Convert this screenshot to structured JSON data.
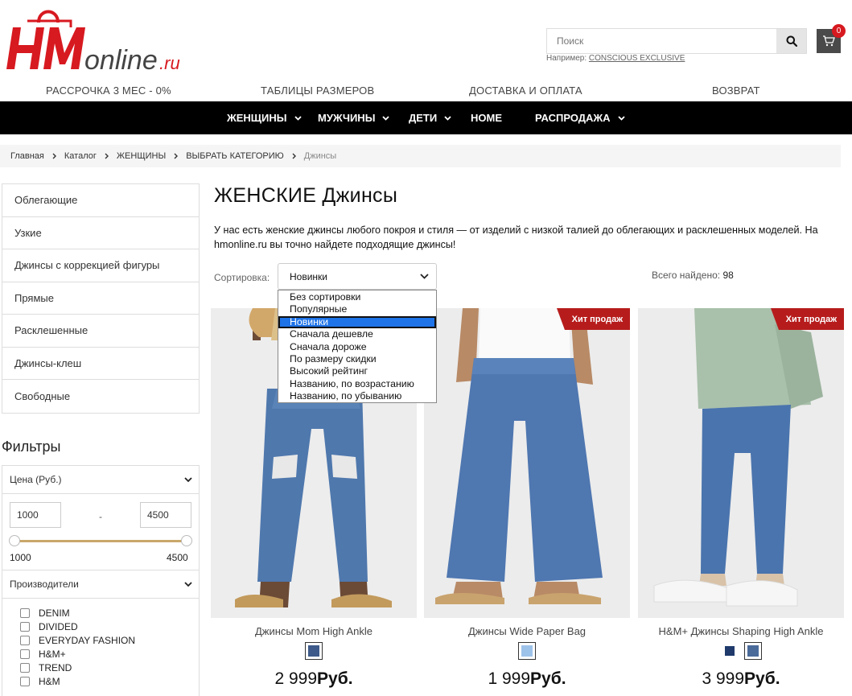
{
  "logo": {
    "brand": "HM",
    "suffix": "online",
    "tld": ".ru"
  },
  "search": {
    "placeholder": "Поиск",
    "hint_prefix": "Например:",
    "hint_link": "CONSCIOUS EXCLUSIVE"
  },
  "cart": {
    "count": "0"
  },
  "infobar": [
    "РАССРОЧКА 3 МЕС - 0%",
    "ТАБЛИЦЫ РАЗМЕРОВ",
    "ДОСТАВКА И ОПЛАТА",
    "ВОЗВРАТ"
  ],
  "nav": [
    "ЖЕНЩИНЫ",
    "МУЖЧИНЫ",
    "ДЕТИ",
    "HOME",
    "РАСПРОДАЖА"
  ],
  "breadcrumb": [
    "Главная",
    "Каталог",
    "ЖЕНЩИНЫ",
    "ВЫБРАТЬ КАТЕГОРИЮ",
    "Джинсы"
  ],
  "categories": [
    "Облегающие",
    "Узкие",
    "Джинсы с коррекцией фигуры",
    "Прямые",
    "Расклешенные",
    "Джинсы-клеш",
    "Свободные"
  ],
  "filters": {
    "title": "Фильтры",
    "price_label": "Цена (Руб.)",
    "price_min": "1000",
    "price_max": "4500",
    "dash": "-",
    "range_min": "1000",
    "range_max": "4500",
    "brands_label": "Производители",
    "brands": [
      "DENIM",
      "DIVIDED",
      "EVERYDAY FASHION",
      "H&M+",
      "TREND",
      "H&M"
    ]
  },
  "page": {
    "title": "ЖЕНСКИЕ Джинсы",
    "intro": "У нас есть женские джинсы любого покроя и стиля — от изделий с низкой талией до облегающих и расклешенных моделей. На hmonline.ru вы точно найдете подходящие джинсы!"
  },
  "sort": {
    "label": "Сортировка:",
    "selected": "Новинки",
    "options": [
      "Без сортировки",
      "Популярные",
      "Новинки",
      "Сначала дешевле",
      "Сначала дороже",
      "По размеру скидки",
      "Высокий рейтинг",
      "Названию, по возрастанию",
      "Названию, по убыванию"
    ]
  },
  "total": {
    "label": "Всего найдено:",
    "value": "98"
  },
  "products": [
    {
      "name": "Джинсы Mom High Ankle",
      "badge": "",
      "price": "2 999",
      "currency": "Руб.",
      "swatches": [
        "#3d5a8a"
      ]
    },
    {
      "name": "Джинсы Wide Paper Bag",
      "badge": "Хит продаж",
      "price": "1 999",
      "currency": "Руб.",
      "swatches": [
        "#9ec3ea"
      ]
    },
    {
      "name": "H&M+ Джинсы Shaping High Ankle",
      "badge": "Хит продаж",
      "price": "3 999",
      "currency": "Руб.",
      "swatches": [
        "#1f3a6b",
        "#4a6a9a"
      ]
    }
  ],
  "colors": {
    "accent": "#d71920",
    "badge": "#b71c1c",
    "nav_bg": "#000000",
    "select_highlight": "#1e73e8"
  }
}
